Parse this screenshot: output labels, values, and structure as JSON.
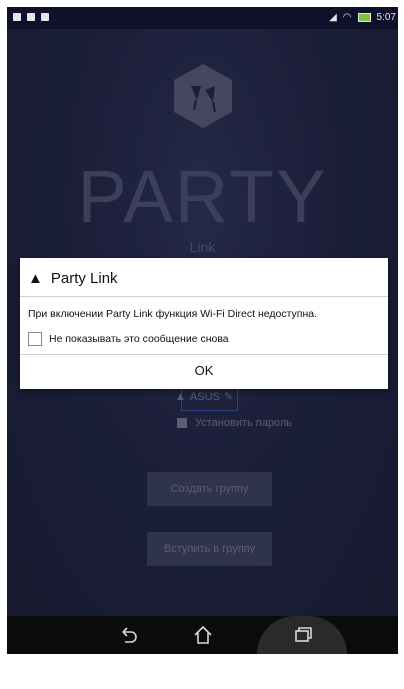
{
  "status_bar": {
    "time": "5:07"
  },
  "app": {
    "title": "PARTY",
    "subtitle": "Link"
  },
  "dialog": {
    "title": "Party Link",
    "message": "При включении Party Link функция Wi-Fi Direct недоступна.",
    "checkbox_label": "Не показывать это сообщение снова",
    "ok_label": "OK"
  },
  "background_form": {
    "name_value": "ASUS",
    "set_password_label": "Установить пароль",
    "create_group_label": "Создать группу",
    "join_group_label": "Вступить в группу"
  },
  "colors": {
    "accent": "#3b6cc9",
    "app_bg": "#2a2e58",
    "dialog_bg": "#ffffff"
  },
  "icons": {
    "back": "back-icon",
    "home": "home-icon",
    "recent": "recent-apps-icon",
    "warning": "warning-icon"
  }
}
